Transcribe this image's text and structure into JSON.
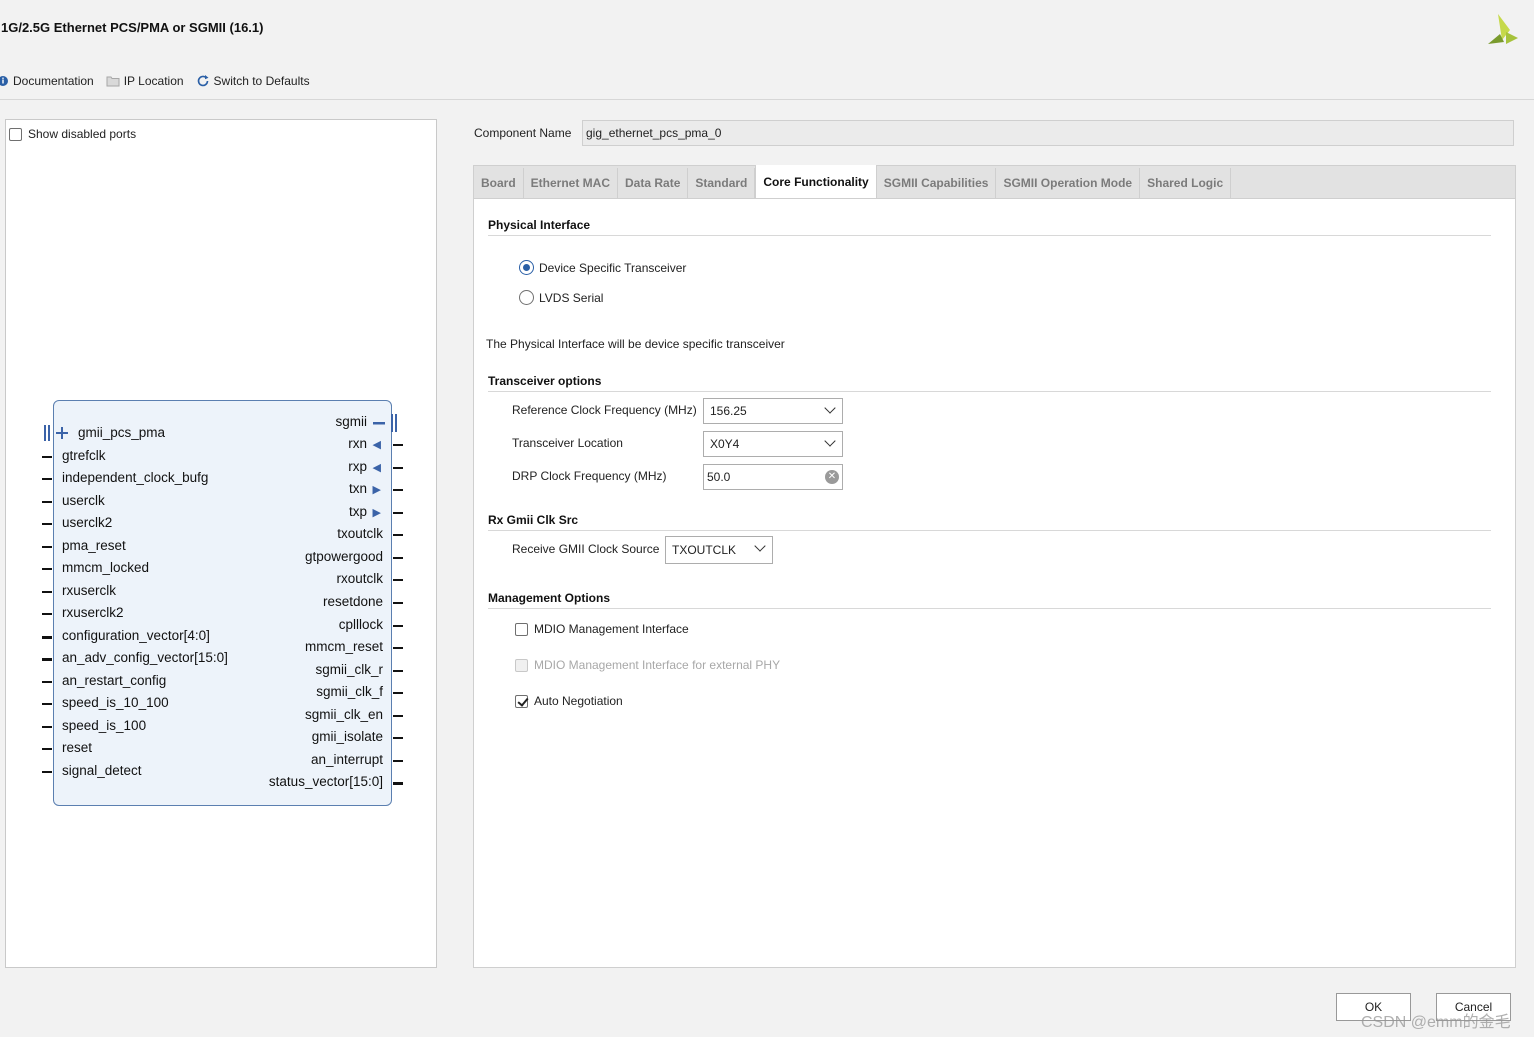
{
  "window": {
    "title": "1G/2.5G Ethernet PCS/PMA or SGMII (16.1)"
  },
  "toolbar": {
    "documentation": "Documentation",
    "ip_location": "IP Location",
    "switch_defaults": "Switch to Defaults"
  },
  "left_panel": {
    "show_disabled_ports": "Show disabled ports",
    "show_disabled_checked": false
  },
  "ip_block": {
    "left_ports": [
      "gmii_pcs_pma",
      "gtrefclk",
      "independent_clock_bufg",
      "userclk",
      "userclk2",
      "pma_reset",
      "mmcm_locked",
      "rxuserclk",
      "rxuserclk2",
      "configuration_vector[4:0]",
      "an_adv_config_vector[15:0]",
      "an_restart_config",
      "speed_is_10_100",
      "speed_is_100",
      "reset",
      "signal_detect"
    ],
    "right_ports": [
      "sgmii",
      "rxn",
      "rxp",
      "txn",
      "txp",
      "txoutclk",
      "gtpowergood",
      "rxoutclk",
      "resetdone",
      "cplllock",
      "mmcm_reset",
      "sgmii_clk_r",
      "sgmii_clk_f",
      "sgmii_clk_en",
      "gmii_isolate",
      "an_interrupt",
      "status_vector[15:0]"
    ]
  },
  "component": {
    "label": "Component Name",
    "value": "gig_ethernet_pcs_pma_0"
  },
  "tabs": [
    "Board",
    "Ethernet MAC",
    "Data Rate",
    "Standard",
    "Core Functionality",
    "SGMII Capabilities",
    "SGMII Operation Mode",
    "Shared Logic"
  ],
  "active_tab": "Core Functionality",
  "physical_interface": {
    "title": "Physical Interface",
    "options": [
      "Device Specific Transceiver",
      "LVDS Serial"
    ],
    "selected": "Device Specific Transceiver",
    "info": "The Physical Interface will be device specific transceiver"
  },
  "transceiver_options": {
    "title": "Transceiver options",
    "ref_clock_label": "Reference Clock Frequency (MHz)",
    "ref_clock_value": "156.25",
    "location_label": "Transceiver Location",
    "location_value": "X0Y4",
    "drp_label": "DRP Clock Frequency (MHz)",
    "drp_value": "50.0"
  },
  "rx_gmii": {
    "title": "Rx Gmii Clk Src",
    "source_label": "Receive GMII Clock Source",
    "source_value": "TXOUTCLK"
  },
  "management": {
    "title": "Management Options",
    "mdio": "MDIO Management Interface",
    "mdio_checked": false,
    "mdio_ext": "MDIO Management Interface for external PHY",
    "mdio_ext_checked": false,
    "auto_neg": "Auto Negotiation",
    "auto_neg_checked": true
  },
  "buttons": {
    "ok": "OK",
    "cancel": "Cancel"
  },
  "watermark": "CSDN @emm的金毛"
}
